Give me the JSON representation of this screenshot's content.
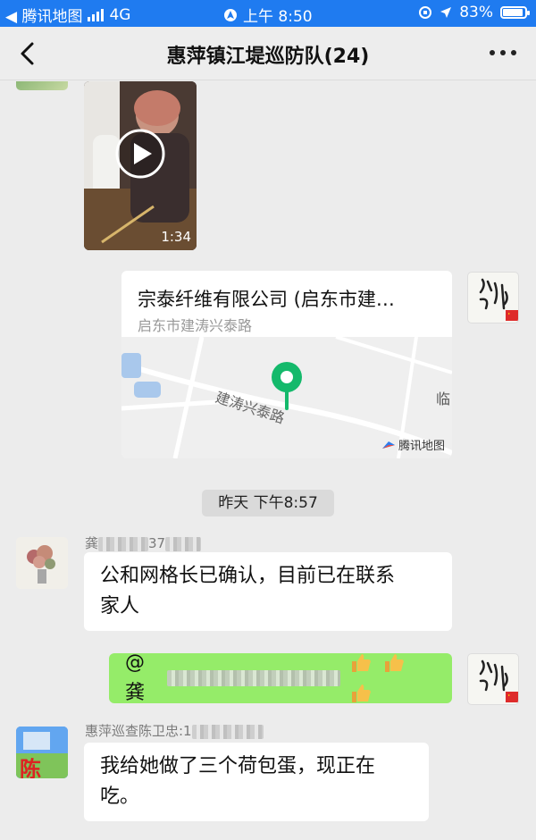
{
  "status_bar": {
    "back_app": "◀ 腾讯地图",
    "network": "4G",
    "time": "上午 8:50",
    "battery": "83%",
    "battery_level": 0.83
  },
  "header": {
    "title": "惠萍镇江堤巡防队(24)"
  },
  "video_message": {
    "duration": "1:34"
  },
  "location_message": {
    "name": "宗泰纤维有限公司 (启东市建…",
    "address": "启东市建涛兴泰路",
    "map_road_label": "建涛兴泰路",
    "map_edge_label": "临",
    "map_provider": "腾讯地图"
  },
  "timestamp": "昨天 下午8:57",
  "messages": [
    {
      "sender_visible": "龚",
      "sender_suffix": "37",
      "text_line1": "公和网格长已确认，目前已在联系",
      "text_line2": "家人"
    },
    {
      "mention": "@龚",
      "emoji": "👍👍👍"
    },
    {
      "sender_visible": "惠萍巡查陈卫忠:1",
      "text_line1": "我给她做了三个荷包蛋，现正在",
      "text_line2": "吃。"
    }
  ],
  "avatar_labels": {
    "chen": "陈"
  }
}
